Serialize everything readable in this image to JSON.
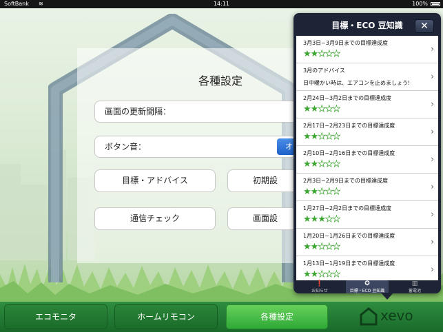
{
  "status_bar": {
    "carrier": "SoftBank",
    "time": "14:11",
    "battery": "100%"
  },
  "settings": {
    "title": "各種設定",
    "refresh_interval_label": "画面の更新間隔：",
    "button_sound_label": "ボタン音：",
    "button_sound_toggle": "オ",
    "buttons": {
      "goals_advice": "目標・アドバイス",
      "initial_settings": "初期設",
      "connection_check": "通信チェック",
      "screen_settings": "画面設"
    }
  },
  "popover": {
    "title": "目標・ECO 豆知識",
    "close_label": "✕",
    "items": [
      {
        "title": "3月3日~3月9日までの目標達成度",
        "stars": 2
      },
      {
        "title": "3月のアドバイス",
        "subtitle": "日中暖かい時は、エアコンを止めましょう!"
      },
      {
        "title": "2月24日~3月2日までの目標達成度",
        "stars": 2
      },
      {
        "title": "2月17日~2月23日までの目標達成度",
        "stars": 2
      },
      {
        "title": "2月10日~2月16日までの目標達成度",
        "stars": 2
      },
      {
        "title": "2月3日~2月9日までの目標達成度",
        "stars": 2
      },
      {
        "title": "1月27日~2月2日までの目標達成度",
        "stars": 3
      },
      {
        "title": "1月20日~1月26日までの目標達成度",
        "stars": 2
      },
      {
        "title": "1月13日~1月19日までの目標達成度",
        "stars": 2
      }
    ],
    "tabs": [
      {
        "label": "お知らせ",
        "icon": "notice-icon"
      },
      {
        "label": "目標・ECO 豆知識",
        "icon": "star-icon"
      },
      {
        "label": "蓄電池",
        "icon": "battery-icon"
      }
    ]
  },
  "tabbar": {
    "tabs": [
      "エコモニタ",
      "ホームリモコン",
      "各種設定"
    ],
    "active_index": 2
  },
  "logo": {
    "text": "xevo"
  },
  "colors": {
    "star_green": "#3aa52f",
    "tab_active": "#4fc447",
    "popover_dark": "#1c2436"
  }
}
